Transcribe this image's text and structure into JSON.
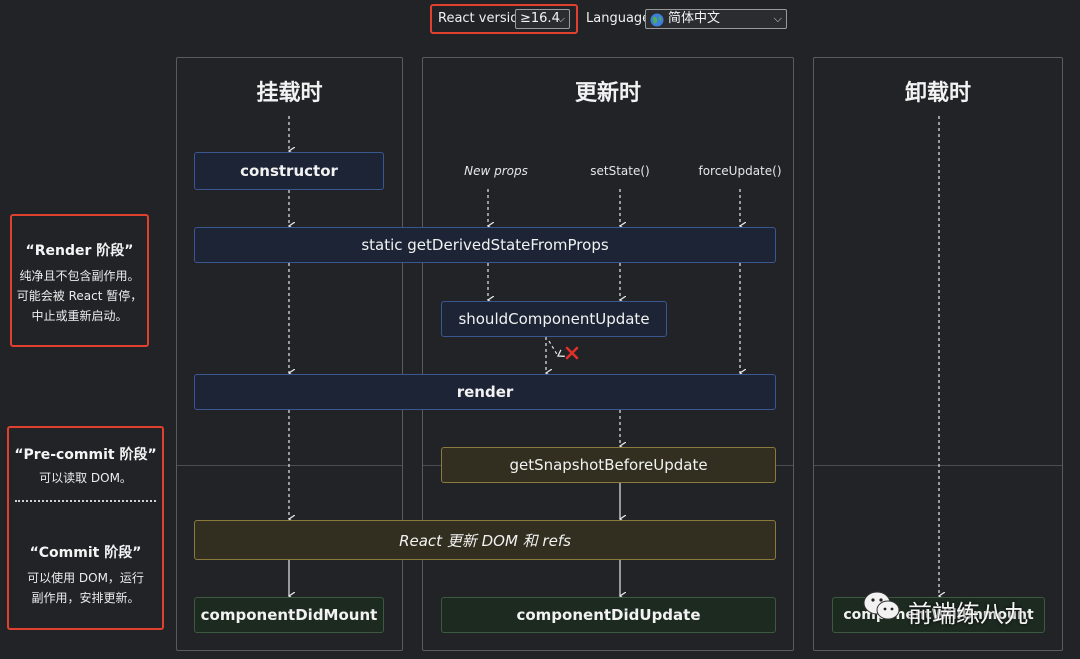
{
  "controls": {
    "react_version_label": "React version",
    "react_version_value": "≥16.4",
    "language_label": "Language",
    "language_value": "简体中文"
  },
  "columns": {
    "mounting": "挂载时",
    "updating": "更新时",
    "unmounting": "卸载时"
  },
  "triggers": {
    "new_props": "New props",
    "set_state": "setState()",
    "force_update": "forceUpdate()"
  },
  "methods": {
    "constructor": "constructor",
    "get_derived_state": "static getDerivedStateFromProps",
    "should_update": "shouldComponentUpdate",
    "render": "render",
    "get_snapshot": "getSnapshotBeforeUpdate",
    "react_updates": "React 更新 DOM 和 refs",
    "did_mount": "componentDidMount",
    "did_update": "componentDidUpdate",
    "will_unmount": "componentWillUnmount"
  },
  "phases": {
    "render_title": "“Render 阶段”",
    "render_desc": [
      "纯净且不包含副作用。",
      "可能会被 React 暂停，",
      "中止或重新启动。"
    ],
    "precommit_title": "“Pre-commit 阶段”",
    "precommit_desc": "可以读取 DOM。",
    "commit_title": "“Commit 阶段”",
    "commit_desc": [
      "可以使用 DOM，运行",
      "副作用，安排更新。"
    ]
  },
  "watermark": {
    "text": "前端练八九"
  },
  "colors": {
    "highlight_red": "#e0402f",
    "render_box_border": "#3a5790",
    "precommit_box_border": "#8a7a3c",
    "commit_box_border": "#3d5a40",
    "stop_mark": "#e0302a"
  },
  "icons": {
    "globe": "globe-icon",
    "stop": "cross-icon",
    "watermark": "wechat-icon"
  }
}
